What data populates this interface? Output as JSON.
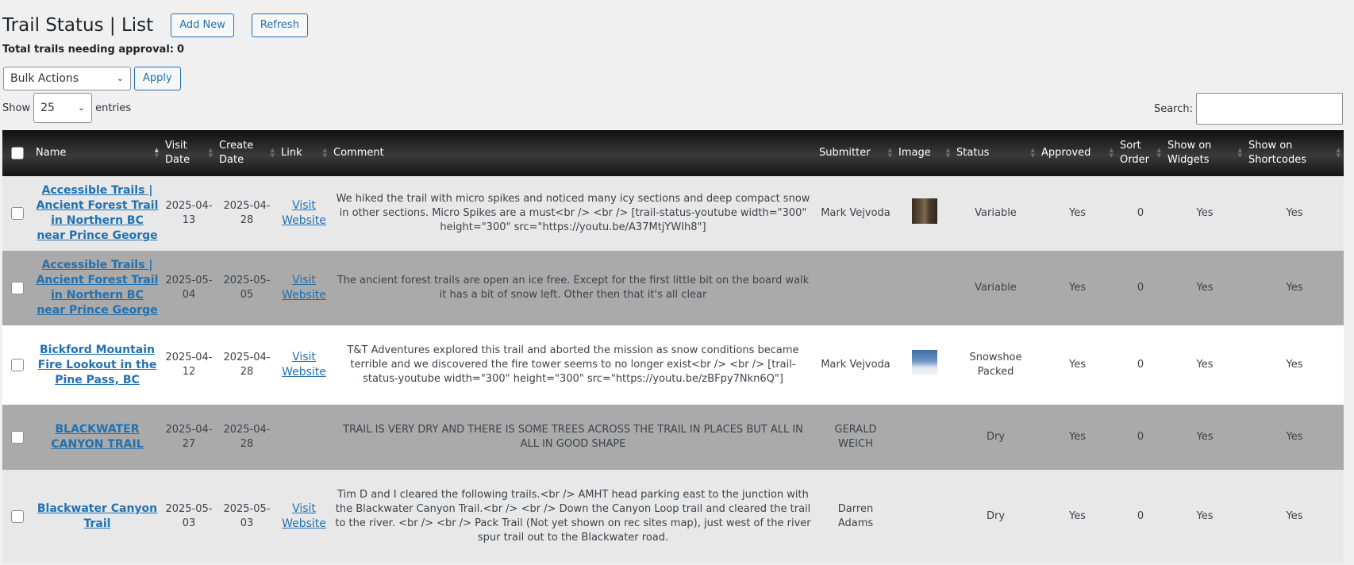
{
  "header": {
    "title": "Trail Status | List",
    "add_new_label": "Add New",
    "refresh_label": "Refresh"
  },
  "approval": {
    "label": "Total trails needing approval:",
    "count": "0"
  },
  "bulk": {
    "selected": "Bulk Actions",
    "apply_label": "Apply"
  },
  "length": {
    "prefix": "Show",
    "selected": "25",
    "suffix": "entries"
  },
  "search": {
    "label": "Search:",
    "placeholder": ""
  },
  "table": {
    "columns": [
      "Name",
      "Visit Date",
      "Create Date",
      "Link",
      "Comment",
      "Submitter",
      "Image",
      "Status",
      "Approved",
      "Sort Order",
      "Show on Widgets",
      "Show on Shortcodes"
    ],
    "rows": [
      {
        "name": "Accessible Trails | Ancient Forest Trail in Northern BC near Prince George",
        "visit_date": "2025-04-13",
        "create_date": "2025-04-28",
        "link": "Visit Website",
        "comment": "We hiked the trail with micro spikes and noticed many icy sections and deep compact snow in other sections. Micro Spikes are a must<br /> <br /> [trail-status-youtube width=\"300\" height=\"300\" src=\"https://youtu.be/A37MtjYWIh8\"]",
        "submitter": "Mark Vejvoda",
        "image": "forest-thumbnail",
        "status": "Variable",
        "approved": "Yes",
        "sort_order": "0",
        "widgets": "Yes",
        "shortcodes": "Yes"
      },
      {
        "name": "Accessible Trails | Ancient Forest Trail in Northern BC near Prince George",
        "visit_date": "2025-05-04",
        "create_date": "2025-05-05",
        "link": "Visit Website",
        "comment": "The ancient forest trails are open an ice free. Except for the first little bit on the board walk it has a bit of snow left. Other then that it's all clear",
        "submitter": "",
        "image": "",
        "status": "Variable",
        "approved": "Yes",
        "sort_order": "0",
        "widgets": "Yes",
        "shortcodes": "Yes"
      },
      {
        "name": "Bickford Mountain Fire Lookout in the Pine Pass, BC",
        "visit_date": "2025-04-12",
        "create_date": "2025-04-28",
        "link": "Visit Website",
        "comment": "T&T Adventures explored this trail and aborted the mission as snow conditions became terrible and we discovered the fire tower seems to no longer exist<br /> <br /> [trail-status-youtube width=\"300\" height=\"300\" src=\"https://youtu.be/zBFpy7Nkn6Q\"]",
        "submitter": "Mark Vejvoda",
        "image": "snow-thumbnail",
        "status": "Snowshoe Packed",
        "approved": "Yes",
        "sort_order": "0",
        "widgets": "Yes",
        "shortcodes": "Yes"
      },
      {
        "name": "BLACKWATER CANYON TRAIL",
        "visit_date": "2025-04-27",
        "create_date": "2025-04-28",
        "link": "",
        "comment": "TRAIL IS VERY DRY AND THERE IS SOME TREES ACROSS THE TRAIL IN PLACES BUT ALL IN ALL IN GOOD SHAPE",
        "submitter": "GERALD WEICH",
        "image": "",
        "status": "Dry",
        "approved": "Yes",
        "sort_order": "0",
        "widgets": "Yes",
        "shortcodes": "Yes"
      },
      {
        "name": "Blackwater Canyon Trail",
        "visit_date": "2025-05-03",
        "create_date": "2025-05-03",
        "link": "Visit Website",
        "comment": "Tim D and I cleared the following trails.<br /> AMHT head parking east to the junction with the Blackwater Canyon Trail.<br /> <br /> Down the Canyon Loop trail and cleared the trail to the river. <br /> <br /> Pack Trail (Not yet shown on rec sites map), just west of the river spur trail out to the Blackwater road.",
        "submitter": "Darren Adams",
        "image": "",
        "status": "Dry",
        "approved": "Yes",
        "sort_order": "0",
        "widgets": "Yes",
        "shortcodes": "Yes"
      }
    ]
  },
  "colors": {
    "accent": "#2271b1",
    "yes": "#2e8b2e",
    "header_dark": "#1a1a1a"
  }
}
